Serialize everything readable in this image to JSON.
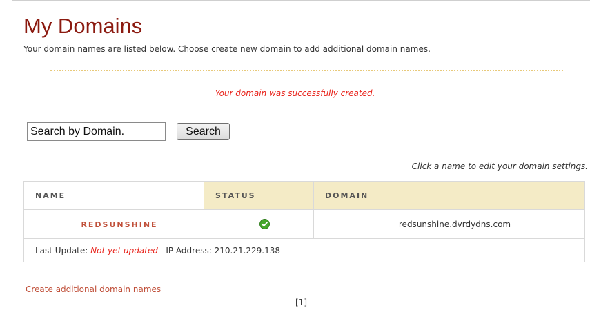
{
  "page": {
    "title": "My Domains",
    "subtitle": "Your domain names are listed below. Choose create new domain to add additional domain names.",
    "success_message": "Your domain was successfully created."
  },
  "search": {
    "value": "Search by Domain.",
    "button_label": "Search"
  },
  "hint": "Click a name to edit your domain settings.",
  "table": {
    "headers": {
      "name": "NAME",
      "status": "STATUS",
      "domain": "DOMAIN"
    },
    "rows": [
      {
        "name": "REDSUNSHINE",
        "status": "ok",
        "status_icon": "check-circle-icon",
        "domain": "redsunshine.dvrdydns.com"
      }
    ],
    "last_update_label": "Last Update:",
    "last_update_value": "Not yet updated",
    "ip_label": "IP Address:",
    "ip_value": "210.21.229.138"
  },
  "create_link": "Create additional domain names",
  "pager": "[1]",
  "colors": {
    "title": "#8b1a10",
    "success": "#e8231b",
    "link": "#c0503a",
    "header_bg": "#f4ebc6",
    "status_ok": "#46a82b"
  }
}
